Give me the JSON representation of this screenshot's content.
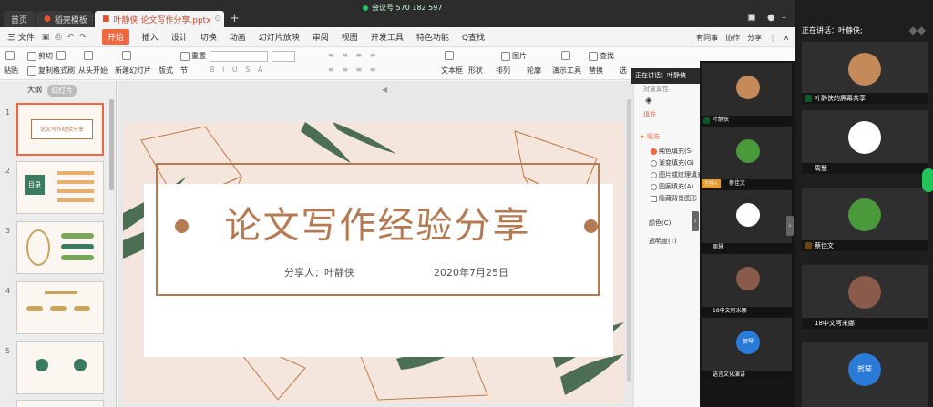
{
  "tabs": {
    "home": "首页",
    "doc1": "稻壳模板",
    "doc2": "叶静侠  论文写作分享.pptx",
    "add": "+"
  },
  "meeting": {
    "id_label": "会议号 570 182 597"
  },
  "menu": {
    "file": "三 文件",
    "items": [
      "开始",
      "插入",
      "设计",
      "切换",
      "动画",
      "幻灯片放映",
      "审阅",
      "视图",
      "开发工具",
      "特色功能",
      "Q查找"
    ],
    "active": "开始",
    "right": [
      "有同事",
      "协作",
      "分享"
    ]
  },
  "ribbon": {
    "paste": "粘贴",
    "cut": "剪切",
    "copy": "复制",
    "format_painter": "格式刷",
    "from_start": "从头开始",
    "new_slide": "新建幻灯片",
    "layout": "版式",
    "section": "节",
    "reset": "重置",
    "textbox": "文本框",
    "shape": "形状",
    "arrange": "排列",
    "picture": "图片",
    "outline": "轮廓",
    "presentation_tools": "演示工具",
    "find": "查找",
    "replace": "替换",
    "select": "选"
  },
  "thumbs": {
    "tabs": [
      "大纲",
      "幻灯片"
    ],
    "active_tab": "幻灯片",
    "numbers": [
      "1",
      "2",
      "3",
      "4",
      "5"
    ],
    "slide1_title": "论文写作经验分享",
    "slide2_title": "目录"
  },
  "slide": {
    "title": "论文写作经验分享",
    "presenter": "分享人：叶静侠",
    "date": "2020年7月25日"
  },
  "props": {
    "header": "对象属性",
    "tab": "填充",
    "section": "▸ 填充",
    "options": [
      "纯色填充(S)",
      "渐变填充(G)",
      "图片或纹理填充",
      "图案填充(A)"
    ],
    "selected": "纯色填充(S)",
    "hide_bg": "隐藏背景图形",
    "color": "颜色(C)",
    "transparency": "透明度(T)"
  },
  "speaking_mini": "正在讲话：叶静侠",
  "strip": {
    "tiles": [
      {
        "name": "叶静侠",
        "color": "#c48a5a"
      },
      {
        "name": "蔡佳文",
        "color": "#4a9a3c",
        "host": "主持人"
      },
      {
        "name": "周慧",
        "color": "#ffffff"
      },
      {
        "name": "18中文阿米娜",
        "color": "#8a5a4a"
      },
      {
        "name": "贺琴",
        "color": "#2a7ad8"
      },
      {
        "name": "语言文化演讲",
        "color": "#555555"
      }
    ],
    "avatar_text": "贺琴"
  },
  "big": {
    "header": "正在讲话：叶静侠;",
    "tiles": [
      {
        "name": "叶静侠的屏幕共享",
        "color": "#c48a5a"
      },
      {
        "name": "周慧",
        "color": "#ffffff"
      },
      {
        "name": "蔡佳文",
        "color": "#4a9a3c"
      },
      {
        "name": "18中文阿米娜",
        "color": "#8a5a4a"
      },
      {
        "name": "贺琴",
        "color": "#2a7ad8"
      }
    ],
    "avatar_text": "贺琴"
  }
}
